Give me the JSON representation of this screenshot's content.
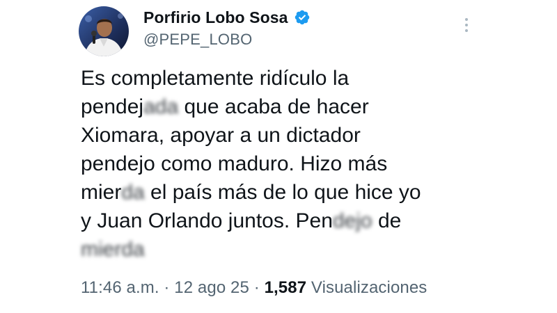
{
  "author": {
    "display_name": "Porfirio Lobo Sosa",
    "handle": "@PEPE_LOBO",
    "verified": true,
    "verified_color": "#1d9bf0"
  },
  "tweet": {
    "lines": [
      [
        {
          "text": "Es completamente ridículo la",
          "blurred": false
        }
      ],
      [
        {
          "text": "pendej",
          "blurred": false
        },
        {
          "text": "ada",
          "blurred": true
        },
        {
          "text": " que acaba de hacer",
          "blurred": false
        }
      ],
      [
        {
          "text": "Xiomara, apoyar a un dictador",
          "blurred": false
        }
      ],
      [
        {
          "text": "pendejo como maduro. Hizo más",
          "blurred": false
        }
      ],
      [
        {
          "text": "mier",
          "blurred": false
        },
        {
          "text": "da",
          "blurred": true
        },
        {
          "text": " el país más de lo que hice yo",
          "blurred": false
        }
      ],
      [
        {
          "text": "y Juan Orlando juntos. Pen",
          "blurred": false
        },
        {
          "text": "dejo",
          "blurred": true
        },
        {
          "text": " de",
          "blurred": false
        }
      ],
      [
        {
          "text": "mierda",
          "blurred": true
        }
      ]
    ]
  },
  "meta": {
    "time": "11:46 a.m.",
    "sep1": " · ",
    "date": "12 ago 25",
    "sep2": " · ",
    "views_count": "1,587",
    "views_label": " Visualizaciones"
  },
  "icons": {
    "more": "more-vertical-icon",
    "verified": "verified-badge-icon"
  },
  "colors": {
    "text": "#0f1419",
    "secondary": "#536471",
    "more_dots": "#aab8c2"
  }
}
